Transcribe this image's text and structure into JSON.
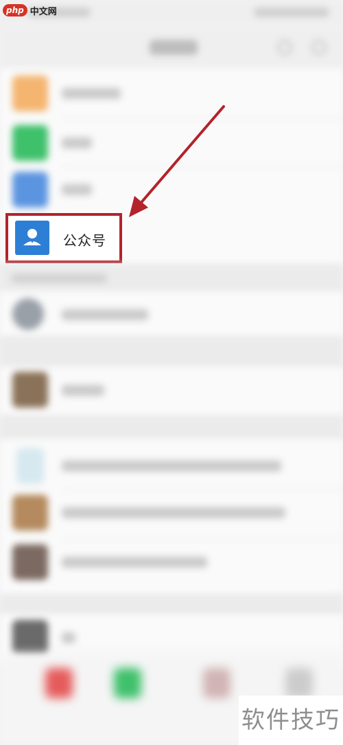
{
  "logo": {
    "badge": "php",
    "site": "中文网"
  },
  "highlighted_item": {
    "label": "公众号",
    "icon": "official-account-icon"
  },
  "watermark": {
    "text": "软件技巧"
  },
  "colors": {
    "highlight_border": "#b3232a",
    "arrow": "#b3232a",
    "oa_icon_bg": "#2d7fd6"
  }
}
